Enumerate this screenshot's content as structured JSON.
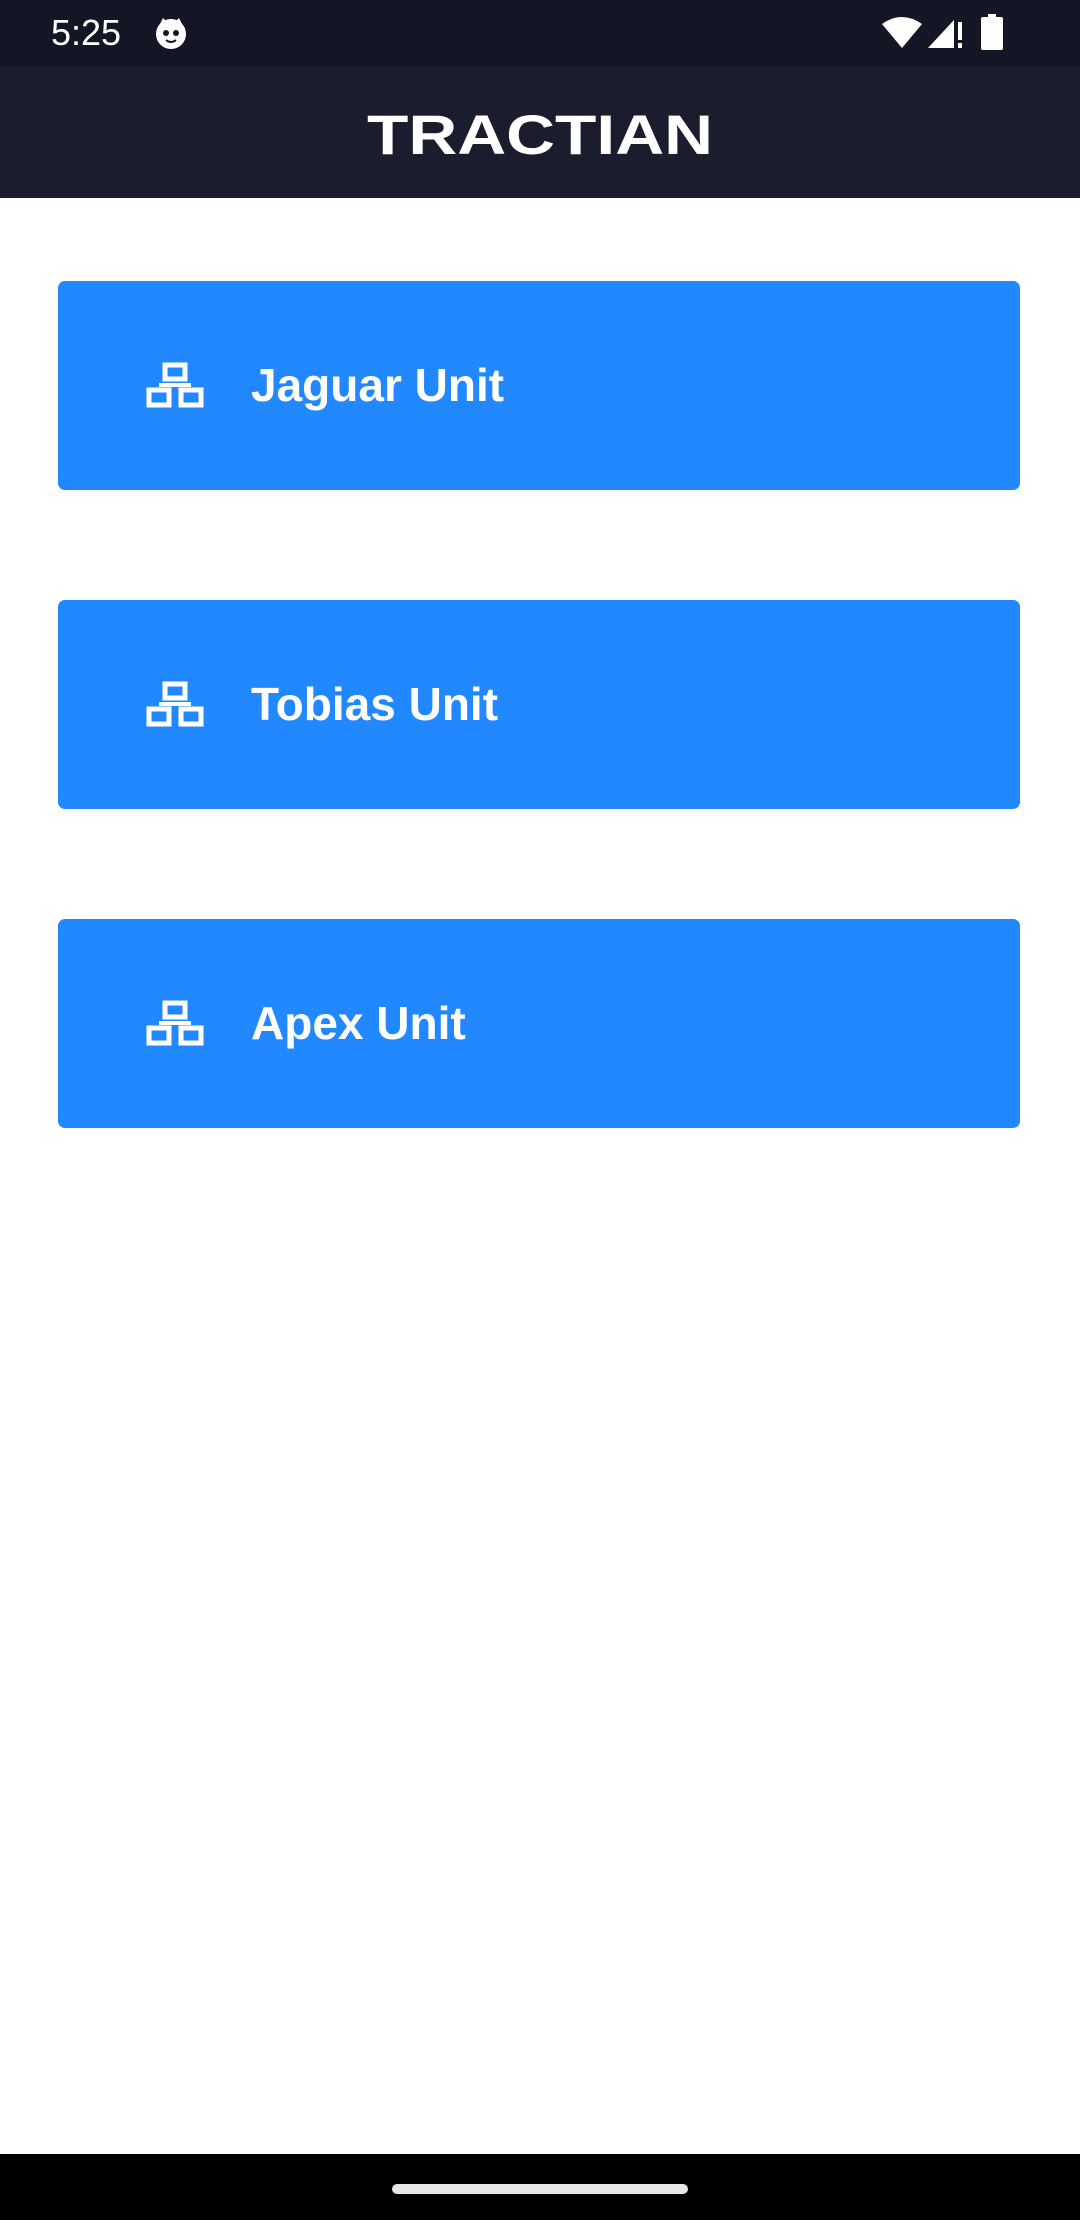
{
  "status_bar": {
    "time": "5:25",
    "icons": [
      "cat-face-icon",
      "wifi-icon",
      "signal-alert-icon",
      "battery-icon"
    ]
  },
  "header": {
    "brand": "TRACTIAN"
  },
  "units": [
    {
      "label": "Jaguar Unit",
      "icon": "hierarchy-icon"
    },
    {
      "label": "Tobias Unit",
      "icon": "hierarchy-icon"
    },
    {
      "label": "Apex Unit",
      "icon": "hierarchy-icon"
    }
  ],
  "colors": {
    "status_bar": "#141626",
    "header": "#1b1d2f",
    "card": "#2188ff",
    "text_on_card": "#ffffff",
    "background": "#ffffff",
    "nav_bar": "#000000"
  }
}
